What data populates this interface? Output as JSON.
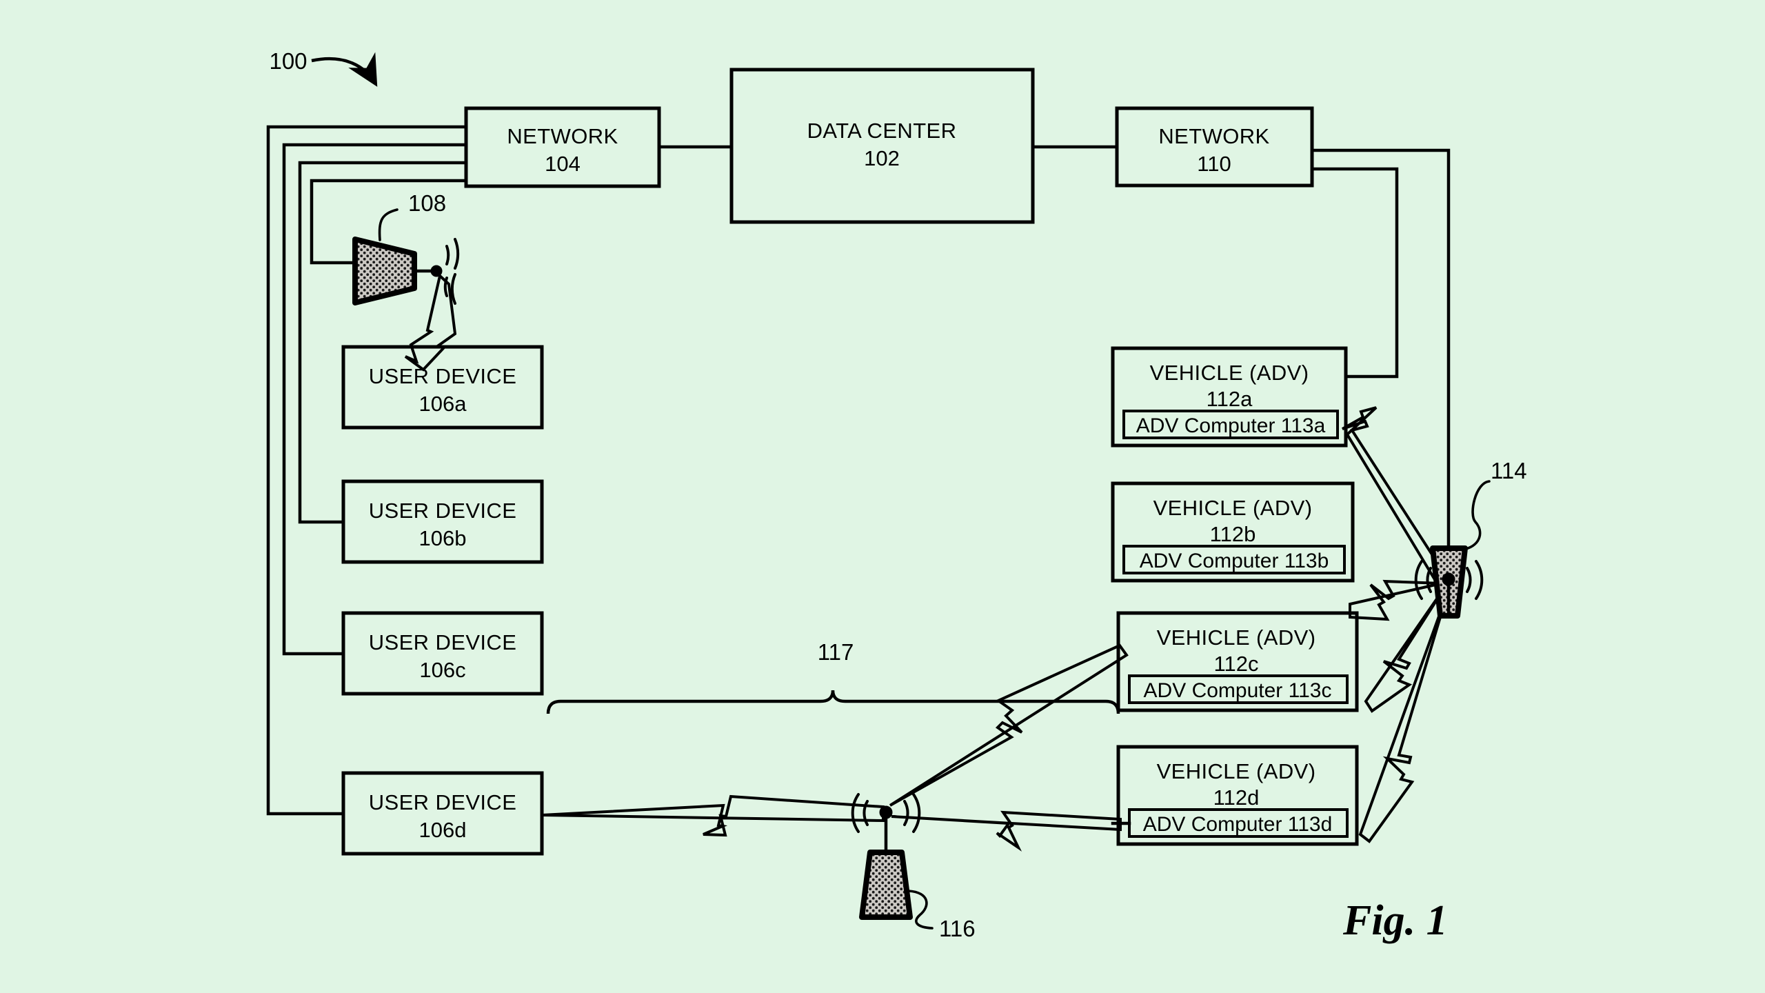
{
  "figure": {
    "label": "Fig. 1",
    "system_ref": "100",
    "background_color": "#e0f5e4",
    "line_color": "#000000"
  },
  "nodes": {
    "data_center": {
      "title": "DATA CENTER",
      "ref": "102"
    },
    "network_left": {
      "title": "NETWORK",
      "ref": "104"
    },
    "network_right": {
      "title": "NETWORK",
      "ref": "110"
    }
  },
  "user_devices": [
    {
      "title": "USER DEVICE",
      "ref": "106a"
    },
    {
      "title": "USER DEVICE",
      "ref": "106b"
    },
    {
      "title": "USER DEVICE",
      "ref": "106c"
    },
    {
      "title": "USER DEVICE",
      "ref": "106d"
    }
  ],
  "vehicles": [
    {
      "title": "VEHICLE (ADV)",
      "ref": "112a",
      "computer": "ADV Computer 113a"
    },
    {
      "title": "VEHICLE (ADV)",
      "ref": "112b",
      "computer": "ADV Computer 113b"
    },
    {
      "title": "VEHICLE (ADV)",
      "ref": "112c",
      "computer": "ADV Computer 113c"
    },
    {
      "title": "VEHICLE (ADV)",
      "ref": "112d",
      "computer": "ADV Computer 113d"
    }
  ],
  "antennas": [
    {
      "ref": "108",
      "orientation": "horizontal"
    },
    {
      "ref": "114",
      "orientation": "vertical"
    },
    {
      "ref": "116",
      "orientation": "vertical"
    }
  ],
  "brace": {
    "ref": "117"
  }
}
